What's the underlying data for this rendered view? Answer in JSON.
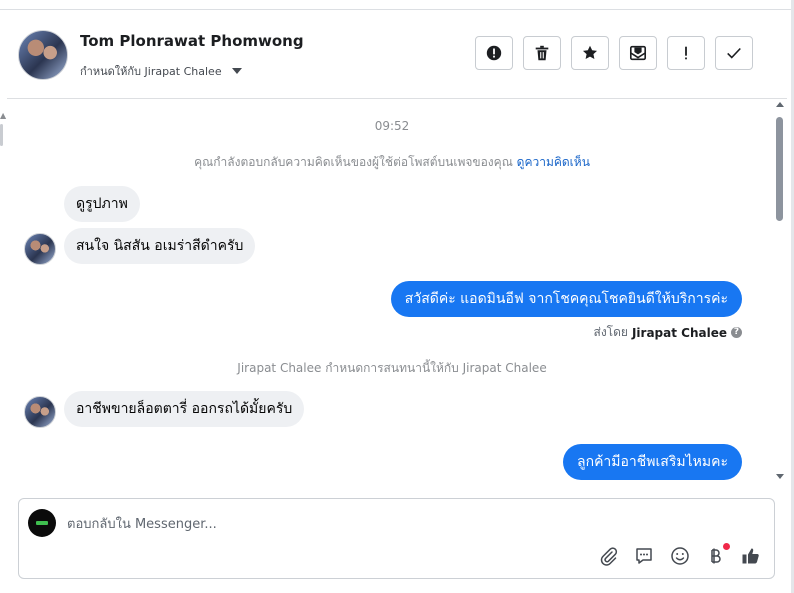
{
  "header": {
    "contact_name": "Tom Plonrawat Phomwong",
    "assigned_label": "กำหนดให้กับ Jirapat Chalee",
    "toolbar_icons": [
      "alert-circle-icon",
      "trash-icon",
      "star-icon",
      "mark-unread-icon",
      "priority-icon",
      "check-icon"
    ]
  },
  "messages": {
    "time": "09:52",
    "notice_text": "คุณกำลังตอบกลับความคิดเห็นของผู้ใช้ต่อโพสต์บนเพจของคุณ",
    "notice_link": "ดูความคิดเห็น",
    "msg1": "ดูรูปภาพ",
    "msg2": "สนใจ นิสสัน อเมร่าสีดำครับ",
    "msg3": "สวัสดีค่ะ แอดมินอีฟ จากโชคคุณโชคยินดีให้บริการค่ะ",
    "sent_by_prefix": "ส่งโดย",
    "sent_by_name": "Jirapat Chalee",
    "assign_note": "Jirapat Chalee กำหนดการสนทนานี้ให้กับ Jirapat Chalee",
    "msg4": "อาชีพขายล็อตตารี่ ออกรถได้มั้ยครับ",
    "msg5": "ลูกค้ามีอาชีพเสริมไหมคะ"
  },
  "composer": {
    "placeholder": "ตอบกลับใน Messenger...",
    "icons": [
      "paperclip-icon",
      "saved-reply-icon",
      "emoji-icon",
      "baht-payment-icon",
      "thumbs-up-icon"
    ]
  },
  "colors": {
    "accent": "#1877f2",
    "incoming_bubble": "#eef0f3",
    "notification_dot": "#f02849",
    "link": "#1a66c9"
  }
}
